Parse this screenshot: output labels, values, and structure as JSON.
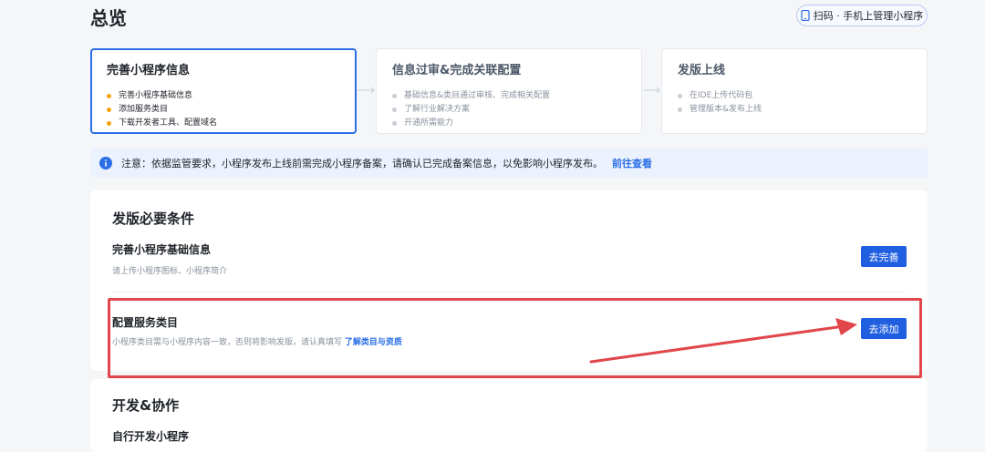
{
  "page_title": "总览",
  "header": {
    "scan_label": "扫码 · 手机上管理小程序"
  },
  "steps": [
    {
      "title": "完善小程序信息",
      "items": [
        "完善小程序基础信息",
        "添加服务类目",
        "下载开发者工具、配置域名"
      ]
    },
    {
      "title": "信息过审&完成关联配置",
      "items": [
        "基础信息&类目通过审核、完成相关配置",
        "了解行业解决方案",
        "开通所需能力"
      ]
    },
    {
      "title": "发版上线",
      "items": [
        "在IDE上传代码包",
        "管理版本&发布上线"
      ]
    }
  ],
  "notice": {
    "text": "注意：依据监管要求，小程序发布上线前需完成小程序备案，请确认已完成备案信息，以免影响小程序发布。",
    "link": "前往查看"
  },
  "release_section": {
    "title": "发版必要条件",
    "items": [
      {
        "title": "完善小程序基础信息",
        "desc": "请上传小程序图标、小程序简介",
        "button": "去完善"
      },
      {
        "title": "配置服务类目",
        "desc": "小程序类目需与小程序内容一致，否则将影响发版，请认真填写",
        "link": "了解类目与资质",
        "button": "去添加"
      }
    ]
  },
  "dev_section": {
    "title": "开发&协作",
    "first_item": "自行开发小程序"
  },
  "colors": {
    "accent": "#2b6ee5",
    "button": "#1f5fe0",
    "highlight": "#e0464a",
    "bullet_active": "#f2a20c"
  }
}
